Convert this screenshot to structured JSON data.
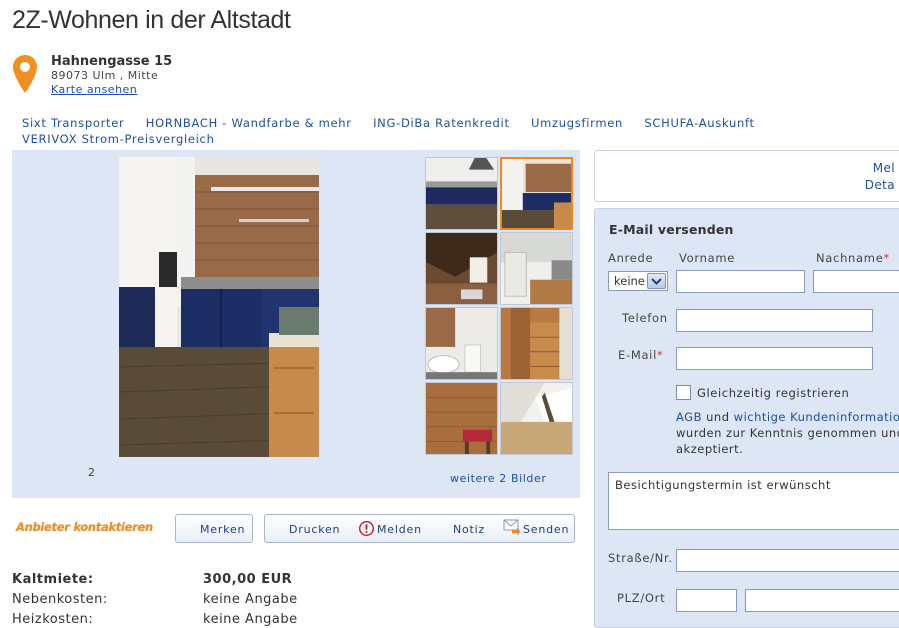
{
  "listing": {
    "title": "2Z-Wohnen in der Altstadt",
    "street": "Hahnengasse 15",
    "city": "89073 Ulm , Mitte",
    "map_link": "Karte ansehen"
  },
  "ad_links": [
    "Sixt Transporter",
    "HORNBACH - Wandfarbe & mehr",
    "ING-DiBa Ratenkredit",
    "Umzugsfirmen",
    "SCHUFA-Auskunft",
    "VERIVOX Strom-Preisvergleich"
  ],
  "gallery": {
    "counter": "2",
    "more_link": "weitere 2 Bilder",
    "active_thumb_index": 1
  },
  "actions": {
    "contact": "Anbieter kontaktieren",
    "merken": "Merken",
    "drucken": "Drucken",
    "melden": "Melden",
    "notiz": "Notiz",
    "senden": "Senden"
  },
  "costs": [
    {
      "label": "Kaltmiete:",
      "value": "300,00 EUR",
      "bold": true
    },
    {
      "label": "Nebenkosten:",
      "value": "keine Angabe",
      "bold": false
    },
    {
      "label": "Heizkosten:",
      "value": "keine Angabe",
      "bold": false
    }
  ],
  "side_box": {
    "line1": "Mel",
    "line2": "Deta"
  },
  "form": {
    "title": "E-Mail versenden",
    "anrede_label": "Anrede",
    "anrede_value": "keine",
    "vorname_label": "Vorname",
    "nachname_label": "Nachname",
    "telefon_label": "Telefon",
    "email_label": "E-Mail",
    "register_label": "Gleichzeitig registrieren",
    "agb_link": "AGB",
    "agb_and": " und ",
    "kunden_link": "wichtige Kundeninformation",
    "agb_line2": "wurden zur Kenntnis genommen und",
    "agb_line3": "akzeptiert.",
    "message": "Besichtigungstermin ist erwünscht",
    "strasse_label": "Straße/Nr.",
    "plz_label": "PLZ/Ort"
  },
  "colors": {
    "accent": "#ee8a1b",
    "link": "#1f4fa0",
    "panel": "#dde6f5",
    "required": "#dd3333"
  }
}
